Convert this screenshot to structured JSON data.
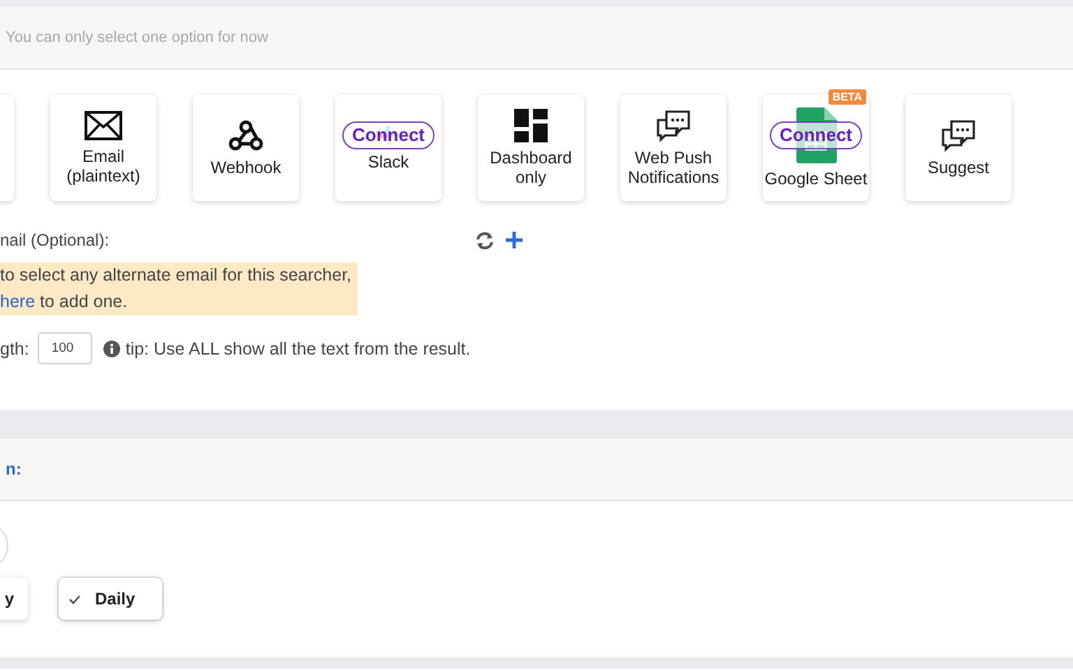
{
  "notice": "You can only select one option for now",
  "channels": [
    {
      "kind": "blank"
    },
    {
      "kind": "email",
      "label": "Email\n(plaintext)"
    },
    {
      "kind": "webhook",
      "label": "Webhook"
    },
    {
      "kind": "slack",
      "label": "Slack",
      "connect": "Connect"
    },
    {
      "kind": "dashboard",
      "label": "Dashboard\nonly"
    },
    {
      "kind": "webpush",
      "label": "Web Push\nNotifications"
    },
    {
      "kind": "gsheet",
      "label": "Google Sheet",
      "connect": "Connect",
      "badge": "BETA"
    },
    {
      "kind": "suggest",
      "label": "Suggest"
    }
  ],
  "alternate_email": {
    "label": "nail (Optional):",
    "warning_line": "to select any alternate email for this searcher,",
    "link": "here",
    "link_after": "to add one."
  },
  "length": {
    "label": "gth:",
    "value": "100",
    "tip": "tip: Use ALL show all the text from the result."
  },
  "schedule": {
    "title": "n:",
    "options": [
      {
        "label": "y",
        "selected": false
      },
      {
        "label": "Daily",
        "selected": true
      }
    ]
  }
}
